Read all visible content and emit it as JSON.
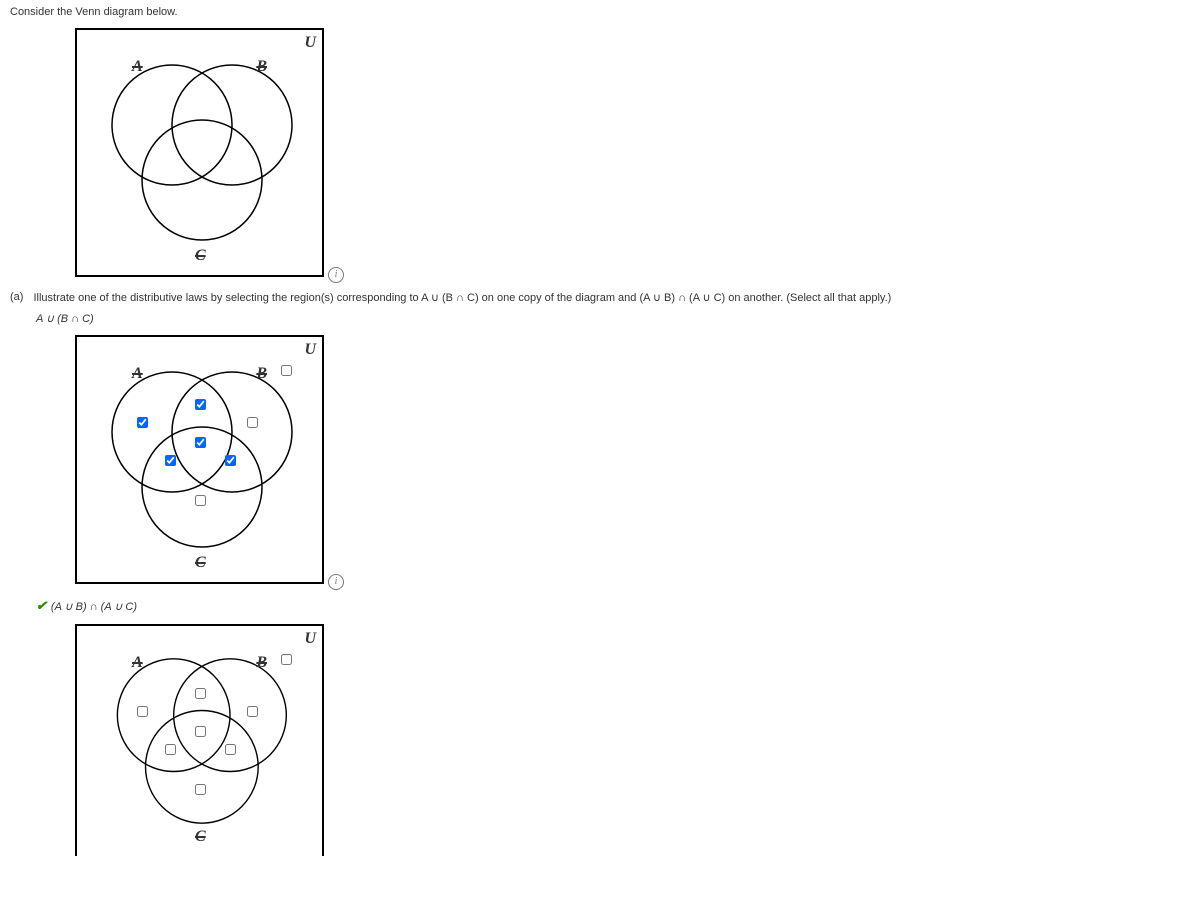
{
  "intro": "Consider the Venn diagram below.",
  "labels": {
    "U": "U",
    "A": "A",
    "B": "B",
    "C": "C"
  },
  "part_a": {
    "label": "(a)",
    "text": "Illustrate one of the distributive laws by selecting the region(s) corresponding to A ∪ (B ∩ C) on one copy of the diagram and (A ∪ B) ∩ (A ∪ C) on another. (Select all that apply.)"
  },
  "expr1": "A ∪ (B ∩ C)",
  "expr2": "(A ∪ B) ∩ (A ∪ C)",
  "info": "i"
}
